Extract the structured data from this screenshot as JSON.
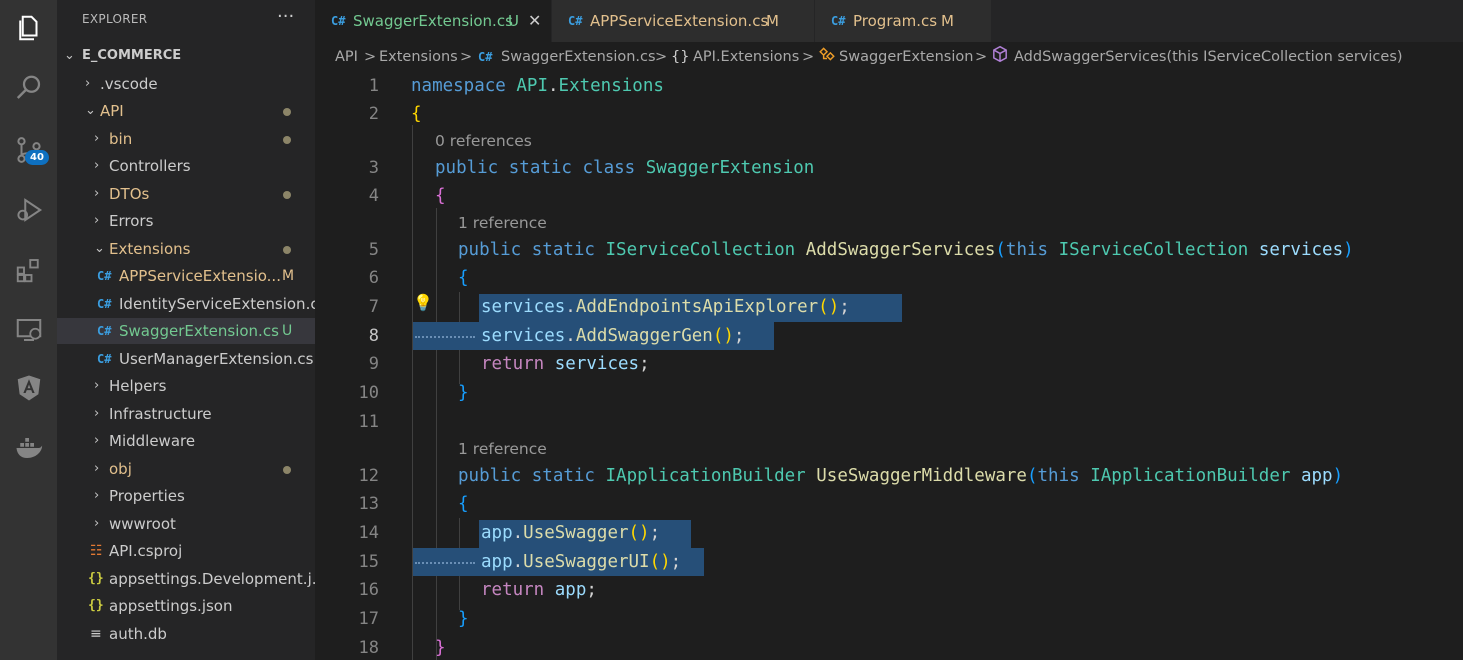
{
  "activity_bar": {
    "icons": [
      "explorer-icon",
      "search-icon",
      "source-control-icon",
      "run-debug-icon",
      "extensions-icon",
      "remote-explorer-icon",
      "angular-icon",
      "docker-icon"
    ],
    "source_control_badge": "40"
  },
  "sidebar": {
    "title": "EXPLORER",
    "more": "···",
    "root": "E_COMMERCE",
    "items": [
      {
        "label": ".vscode"
      },
      {
        "label": "API"
      },
      {
        "label": "bin"
      },
      {
        "label": "Controllers"
      },
      {
        "label": "DTOs"
      },
      {
        "label": "Errors"
      },
      {
        "label": "Extensions"
      },
      {
        "label": "APPServiceExtensio...",
        "status": "M"
      },
      {
        "label": "IdentityServiceExtension.cs"
      },
      {
        "label": "SwaggerExtension.cs",
        "status": "U"
      },
      {
        "label": "UserManagerExtension.cs"
      },
      {
        "label": "Helpers"
      },
      {
        "label": "Infrastructure"
      },
      {
        "label": "Middleware"
      },
      {
        "label": "obj"
      },
      {
        "label": "Properties"
      },
      {
        "label": "wwwroot"
      },
      {
        "label": "API.csproj"
      },
      {
        "label": "appsettings.Development.j..."
      },
      {
        "label": "appsettings.json"
      },
      {
        "label": "auth.db"
      }
    ],
    "icon_glyphs": {
      "cs": "C#",
      "json": "{}",
      "proj": "☷",
      "db": "≡"
    }
  },
  "tabs": [
    {
      "label": "SwaggerExtension.cs",
      "status": "U",
      "close": "✕"
    },
    {
      "label": "APPServiceExtension.cs",
      "status": "M"
    },
    {
      "label": "Program.cs",
      "status": "M"
    }
  ],
  "breadcrumb": {
    "items": [
      "API",
      "Extensions",
      "SwaggerExtension.cs",
      "API.Extensions",
      "SwaggerExtension",
      "AddSwaggerServices(this IServiceCollection services)"
    ],
    "separator": ">",
    "namespace_glyph": "{}",
    "cs_glyph": "C#"
  },
  "editor": {
    "line_numbers": [
      "1",
      "2",
      "3",
      "4",
      "5",
      "6",
      "7",
      "8",
      "9",
      "10",
      "11",
      "12",
      "13",
      "14",
      "15",
      "16",
      "17",
      "18"
    ],
    "codelens": [
      "0 references",
      "1 reference",
      "1 reference"
    ],
    "lines": {
      "l1_kw": "namespace",
      "l1_ns": "API",
      "l1_dot": ".",
      "l1_ns2": "Extensions",
      "l2": "{",
      "l3_kw": "public static class",
      "l3_ty": "SwaggerExtension",
      "l4": "{",
      "l5_kw": "public static",
      "l5_ty": "IServiceCollection",
      "l5_fn": "AddSwaggerServices",
      "l5_p1": "(",
      "l5_this": "this",
      "l5_ty2": "IServiceCollection",
      "l5_var": "services",
      "l5_p2": ")",
      "l6": "{",
      "l7_var": "services",
      "l7_dot": ".",
      "l7_fn": "AddEndpointsApiExplorer",
      "l7_par": "()",
      "l7_semi": ";",
      "l8_var": "services",
      "l8_dot": ".",
      "l8_fn": "AddSwaggerGen",
      "l8_par": "()",
      "l8_semi": ";",
      "l9_kw": "return",
      "l9_var": "services",
      "l9_semi": ";",
      "l10": "}",
      "l12_kw": "public static",
      "l12_ty": "IApplicationBuilder",
      "l12_fn": "UseSwaggerMiddleware",
      "l12_p1": "(",
      "l12_this": "this",
      "l12_ty2": "IApplicationBuilder",
      "l12_var": "app",
      "l12_p2": ")",
      "l13": "{",
      "l14_var": "app",
      "l14_dot": ".",
      "l14_fn": "UseSwagger",
      "l14_par": "()",
      "l14_semi": ";",
      "l15_var": "app",
      "l15_dot": ".",
      "l15_fn": "UseSwaggerUI",
      "l15_par": "()",
      "l15_semi": ";",
      "l16_kw": "return",
      "l16_var": "app",
      "l16_semi": ";",
      "l17": "}",
      "l18": "}"
    },
    "lightbulb": "💡"
  }
}
